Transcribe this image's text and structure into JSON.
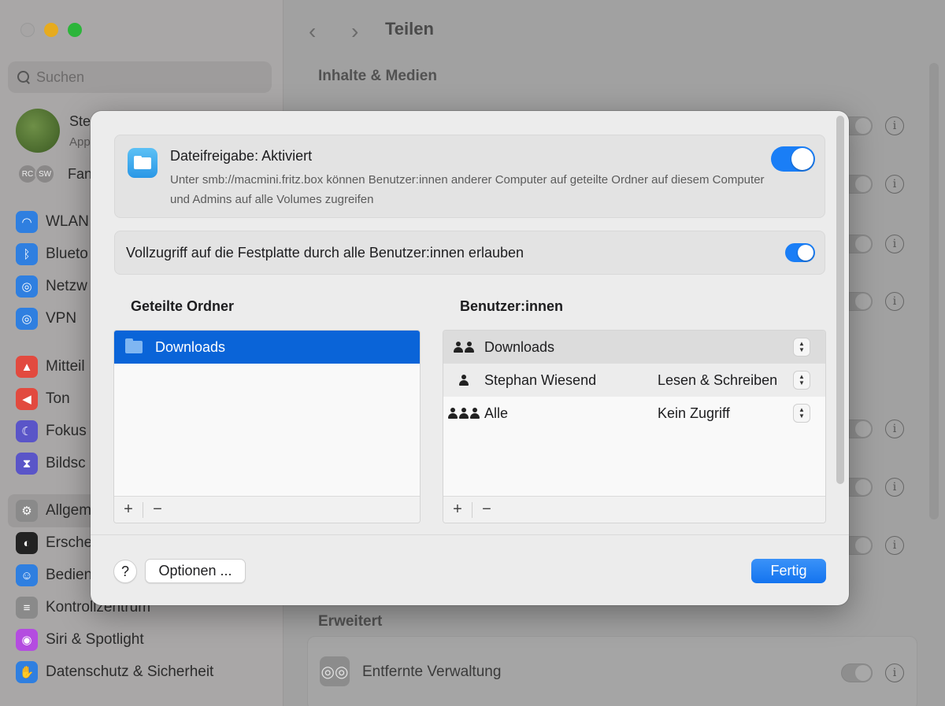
{
  "window": {
    "search_placeholder": "Suchen",
    "profile": {
      "name": "Ste",
      "sub": "App"
    },
    "family": {
      "badges": [
        "RC",
        "SW"
      ],
      "label": "Fan"
    },
    "sidebar_items": [
      {
        "label": "WLAN",
        "icon": "wifi-icon",
        "color": "#2f7fe0"
      },
      {
        "label": "Blueto",
        "icon": "bluetooth-icon",
        "color": "#2f7fe0"
      },
      {
        "label": "Netzw",
        "icon": "globe-icon",
        "color": "#2f7fe0"
      },
      {
        "label": "VPN",
        "icon": "vpn-globe-icon",
        "color": "#2f7fe0"
      },
      {
        "label": "Mitteil",
        "icon": "bell-icon",
        "color": "#e24a3f"
      },
      {
        "label": "Ton",
        "icon": "speaker-icon",
        "color": "#e24a3f"
      },
      {
        "label": "Fokus",
        "icon": "moon-icon",
        "color": "#5a55c8"
      },
      {
        "label": "Bildsc",
        "icon": "hourglass-icon",
        "color": "#5a55c8"
      },
      {
        "label": "Allgem",
        "icon": "gear-icon",
        "color": "#8a8a8a"
      },
      {
        "label": "Ersche",
        "icon": "appearance-icon",
        "color": "#222222"
      },
      {
        "label": "Bedien",
        "icon": "accessibility-icon",
        "color": "#2f7fe0"
      },
      {
        "label": "Kontrollzentrum",
        "icon": "control-center-icon",
        "color": "#8a8a8a"
      },
      {
        "label": "Siri & Spotlight",
        "icon": "siri-icon",
        "color": "#b44ce0"
      },
      {
        "label": "Datenschutz & Sicherheit",
        "icon": "hand-icon",
        "color": "#2f7fe0"
      }
    ],
    "title": "Teilen",
    "section_media": "Inhalte & Medien",
    "section_advanced": "Erweitert",
    "remote_management": "Entfernte Verwaltung",
    "info_glyph": "i"
  },
  "dialog": {
    "file_sharing": {
      "title": "Dateifreigabe: Aktiviert",
      "description": "Unter smb://macmini.fritz.box können Benutzer:innen anderer Computer auf geteilte Ordner auf diesem Computer und Admins auf alle Volumes zugreifen",
      "enabled": true
    },
    "full_access": {
      "label": "Vollzugriff auf die Festplatte durch alle Benutzer:innen erlauben",
      "enabled": true
    },
    "shared_folders": {
      "header": "Geteilte Ordner",
      "items": [
        "Downloads"
      ],
      "add": "+",
      "remove": "−"
    },
    "users": {
      "header": "Benutzer:innen",
      "rows": [
        {
          "name": "Downloads",
          "permission": "",
          "icon": "group-icon"
        },
        {
          "name": "Stephan Wiesend",
          "permission": "Lesen & Schreiben",
          "icon": "person-icon"
        },
        {
          "name": "Alle",
          "permission": "Kein Zugriff",
          "icon": "everyone-icon"
        }
      ],
      "add": "+",
      "remove": "−"
    },
    "help": "?",
    "options": "Optionen ...",
    "done": "Fertig"
  }
}
